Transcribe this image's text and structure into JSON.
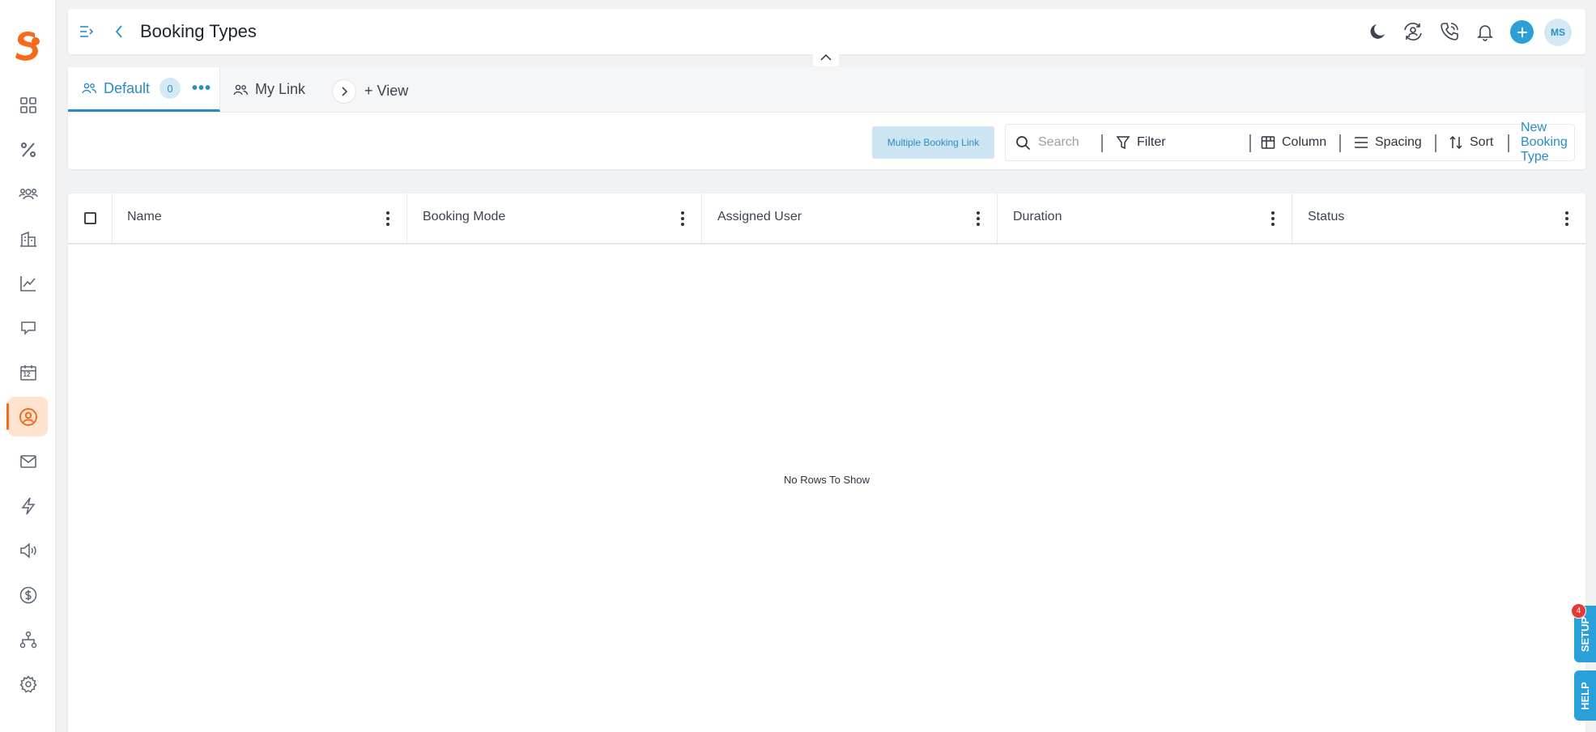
{
  "brand": {
    "accent": "#f56b1b",
    "primary": "#2a8cc4",
    "button_blue": "#2aa0d8"
  },
  "sidebar": {
    "items": [
      {
        "icon": "dashboard-icon"
      },
      {
        "icon": "percent-icon"
      },
      {
        "icon": "users-icon"
      },
      {
        "icon": "building-icon"
      },
      {
        "icon": "chart-line-icon"
      },
      {
        "icon": "chat-icon"
      },
      {
        "icon": "calendar-icon",
        "badge_text": "12"
      },
      {
        "icon": "contact-icon",
        "active": true
      },
      {
        "icon": "mail-icon"
      },
      {
        "icon": "lightning-icon"
      },
      {
        "icon": "megaphone-icon"
      },
      {
        "icon": "dollar-icon"
      },
      {
        "icon": "hierarchy-icon"
      },
      {
        "icon": "gear-icon"
      }
    ]
  },
  "header": {
    "title": "Booking Types",
    "avatar_initials": "MS",
    "icons": [
      "moon-icon",
      "user-sync-icon",
      "phone-icon",
      "bell-icon",
      "add-icon"
    ]
  },
  "view_tabs": {
    "tabs": [
      {
        "label": "Default",
        "count": "0",
        "active": true
      },
      {
        "label": "My Link",
        "active": false
      }
    ],
    "add_view_label": "+ View"
  },
  "toolbar": {
    "multiple_booking_label": "Multiple Booking Link",
    "search_placeholder": "Search",
    "filter_label": "Filter",
    "column_label": "Column",
    "spacing_label": "Spacing",
    "sort_label": "Sort",
    "new_label": "New Booking Type"
  },
  "table": {
    "columns": [
      "Name",
      "Booking Mode",
      "Assigned User",
      "Duration",
      "Status"
    ],
    "rows": [],
    "empty_message": "No Rows To Show"
  },
  "floating": {
    "setup_label": "SETUP",
    "setup_badge": "4",
    "help_label": "HELP"
  }
}
